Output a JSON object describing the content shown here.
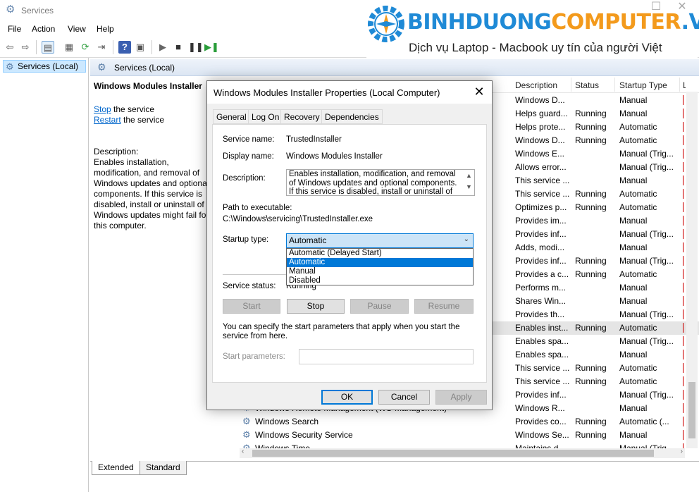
{
  "window": {
    "title": "Services",
    "minimize": "—",
    "maximize": "☐",
    "close": "✕"
  },
  "menu": [
    "File",
    "Action",
    "View",
    "Help"
  ],
  "logo": {
    "name_part1": "BINHDUONG",
    "name_part2": "COMPUTER",
    "name_part3": ".VN",
    "tagline": "Dịch vụ Laptop - Macbook uy tín của người Việt"
  },
  "tree": {
    "root_label": "Services (Local)"
  },
  "main_header": {
    "title": "Services (Local)"
  },
  "desc_pane": {
    "service_title": "Windows Modules Installer",
    "stop_link": "Stop",
    "stop_suffix": " the service",
    "restart_link": "Restart",
    "restart_suffix": " the service",
    "description_label": "Description:",
    "description_text": "Enables installation, modification, and removal of Windows updates and optional components. If this service is disabled, install or uninstall of Windows updates might fail for this computer."
  },
  "list": {
    "columns": [
      "Description",
      "Status",
      "Startup Type",
      "L"
    ],
    "rows": [
      {
        "name": "",
        "desc": "Windows D...",
        "status": "",
        "startup": "Manual"
      },
      {
        "name": "",
        "desc": "Helps guard...",
        "status": "Running",
        "startup": "Manual"
      },
      {
        "name": "",
        "desc": "Helps prote...",
        "status": "Running",
        "startup": "Automatic"
      },
      {
        "name": "",
        "desc": "Windows D...",
        "status": "Running",
        "startup": "Automatic"
      },
      {
        "name": "",
        "desc": "Windows E...",
        "status": "",
        "startup": "Manual (Trig..."
      },
      {
        "name": "",
        "desc": "Allows error...",
        "status": "",
        "startup": "Manual (Trig..."
      },
      {
        "name": "",
        "desc": "This service ...",
        "status": "",
        "startup": "Manual"
      },
      {
        "name": "",
        "desc": "This service ...",
        "status": "Running",
        "startup": "Automatic"
      },
      {
        "name": "",
        "desc": "Optimizes p...",
        "status": "Running",
        "startup": "Automatic"
      },
      {
        "name": "",
        "desc": "Provides im...",
        "status": "",
        "startup": "Manual"
      },
      {
        "name": "",
        "desc": "Provides inf...",
        "status": "",
        "startup": "Manual (Trig..."
      },
      {
        "name": "",
        "desc": "Adds, modi...",
        "status": "",
        "startup": "Manual"
      },
      {
        "name": "",
        "desc": "Provides inf...",
        "status": "Running",
        "startup": "Manual (Trig..."
      },
      {
        "name": "",
        "desc": "Provides a c...",
        "status": "Running",
        "startup": "Automatic"
      },
      {
        "name": "",
        "desc": "Performs m...",
        "status": "",
        "startup": "Manual"
      },
      {
        "name": "",
        "desc": "Shares Win...",
        "status": "",
        "startup": "Manual"
      },
      {
        "name": "",
        "desc": "Provides th...",
        "status": "",
        "startup": "Manual (Trig..."
      },
      {
        "name": "",
        "desc": "Enables inst...",
        "status": "Running",
        "startup": "Automatic"
      },
      {
        "name": "",
        "desc": "Enables spa...",
        "status": "",
        "startup": "Manual (Trig..."
      },
      {
        "name": "",
        "desc": "Enables spa...",
        "status": "",
        "startup": "Manual"
      },
      {
        "name": "",
        "desc": "This service ...",
        "status": "Running",
        "startup": "Automatic"
      },
      {
        "name": "",
        "desc": "This service ...",
        "status": "Running",
        "startup": "Automatic"
      },
      {
        "name": "",
        "desc": "Provides inf...",
        "status": "",
        "startup": "Manual (Trig..."
      },
      {
        "name": "Windows Remote Management (WS-Management)",
        "desc": "Windows R...",
        "status": "",
        "startup": "Manual"
      },
      {
        "name": "Windows Search",
        "desc": "Provides co...",
        "status": "Running",
        "startup": "Automatic (..."
      },
      {
        "name": "Windows Security Service",
        "desc": "Windows Se...",
        "status": "Running",
        "startup": "Manual"
      },
      {
        "name": "Windows Time",
        "desc": "Maintains d...",
        "status": "",
        "startup": "Manual (Trig..."
      }
    ]
  },
  "bottom_tabs": [
    "Extended",
    "Standard"
  ],
  "dialog": {
    "title": "Windows Modules Installer Properties (Local Computer)",
    "tabs": [
      "General",
      "Log On",
      "Recovery",
      "Dependencies"
    ],
    "service_name_label": "Service name:",
    "service_name_value": "TrustedInstaller",
    "display_name_label": "Display name:",
    "display_name_value": "Windows Modules Installer",
    "description_label": "Description:",
    "description_value": "Enables installation, modification, and removal of Windows updates and optional components. If this service is disabled, install or uninstall of Windows",
    "path_label": "Path to executable:",
    "path_value": "C:\\Windows\\servicing\\TrustedInstaller.exe",
    "startup_type_label": "Startup type:",
    "startup_type_value": "Automatic",
    "startup_options": [
      "Automatic (Delayed Start)",
      "Automatic",
      "Manual",
      "Disabled"
    ],
    "service_status_label": "Service status:",
    "service_status_value": "Running",
    "buttons": {
      "start": "Start",
      "stop": "Stop",
      "pause": "Pause",
      "resume": "Resume"
    },
    "help_text": "You can specify the start parameters that apply when you start the service from here.",
    "start_params_label": "Start parameters:",
    "footer": {
      "ok": "OK",
      "cancel": "Cancel",
      "apply": "Apply"
    }
  },
  "colors": {
    "selection": "#cce8ff",
    "accent": "#0078d7",
    "link": "#0066cc",
    "logo_blue": "#1f8ad6",
    "logo_orange": "#f39a1c"
  }
}
